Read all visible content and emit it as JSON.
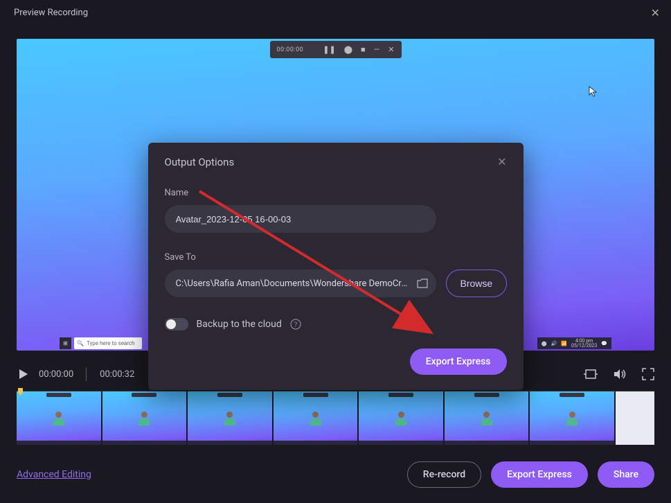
{
  "titlebar": {
    "title": "Preview Recording"
  },
  "mini_player": {
    "time": "00:00:00"
  },
  "taskbar": {
    "search_placeholder": "Type here to search",
    "date": "05/12/2023",
    "time": "4:00 pm"
  },
  "playback": {
    "current_time": "00:00:00",
    "duration": "00:00:32"
  },
  "modal": {
    "title": "Output Options",
    "name_label": "Name",
    "name_value": "Avatar_2023-12-05 16-00-03",
    "save_label": "Save To",
    "save_path": "C:\\Users\\Rafia Aman\\Documents\\Wondershare DemoCre...",
    "browse_label": "Browse",
    "backup_label": "Backup to the cloud",
    "export_label": "Export Express"
  },
  "footer": {
    "advanced": "Advanced Editing",
    "rerecord": "Re-record",
    "export": "Export Express",
    "share": "Share"
  }
}
